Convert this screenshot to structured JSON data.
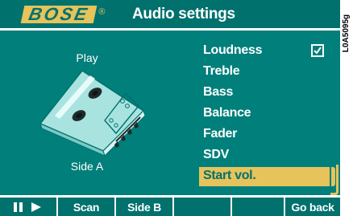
{
  "header": {
    "brand": "BOSE",
    "brand_mark": "®",
    "title": "Audio settings"
  },
  "side_code": "L0A5095g",
  "left_panel": {
    "play_label": "Play",
    "side_label": "Side A",
    "cassette_icon": "cassette-tape-icon"
  },
  "menu": {
    "items": [
      {
        "label": "Loudness",
        "checked": true
      },
      {
        "label": "Treble"
      },
      {
        "label": "Bass"
      },
      {
        "label": "Balance"
      },
      {
        "label": "Fader"
      },
      {
        "label": "SDV"
      },
      {
        "label": "Start vol.",
        "selected": true
      }
    ]
  },
  "footer": {
    "buttons": [
      {
        "label": "",
        "icons": [
          "pause-icon",
          "play-icon"
        ]
      },
      {
        "label": "Scan"
      },
      {
        "label": "Side B"
      },
      {
        "label": ""
      },
      {
        "label": ""
      },
      {
        "label": "Go back"
      }
    ]
  },
  "colors": {
    "screen_bg": "#007f7b",
    "header_bg": "#00716d",
    "accent": "#e6c35b",
    "text": "#ffffff"
  }
}
